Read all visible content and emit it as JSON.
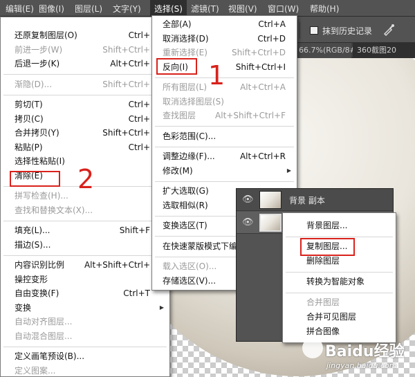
{
  "menubar": {
    "items": [
      {
        "label": "编辑(E)",
        "active": false
      },
      {
        "label": "图像(I)",
        "active": false
      },
      {
        "label": "图层(L)",
        "active": false
      },
      {
        "label": "文字(Y)",
        "active": false
      },
      {
        "label": "选择(S)",
        "active": true
      },
      {
        "label": "滤镜(T)",
        "active": false
      },
      {
        "label": "视图(V)",
        "active": false
      },
      {
        "label": "窗口(W)",
        "active": false
      },
      {
        "label": "帮助(H)",
        "active": false
      }
    ]
  },
  "options_bar": {
    "sample_all_layers_checkbox": false,
    "erase_to_history_label": "抹到历史记录",
    "brush_icon": "airbrush-icon"
  },
  "document_tabs": [
    {
      "label": "66.7%(RGB/8#)"
    },
    {
      "label": "360截图20"
    }
  ],
  "edit_menu": {
    "items": [
      {
        "label": "还原复制图层(O)",
        "shortcut": "Ctrl+",
        "disabled": false
      },
      {
        "label": "前进一步(W)",
        "shortcut": "Shift+Ctrl+",
        "disabled": true
      },
      {
        "label": "后退一步(K)",
        "shortcut": "Alt+Ctrl+",
        "disabled": false
      },
      {
        "sep": true
      },
      {
        "label": "渐隐(D)...",
        "shortcut": "Shift+Ctrl+",
        "disabled": true
      },
      {
        "sep": true
      },
      {
        "label": "剪切(T)",
        "shortcut": "Ctrl+",
        "disabled": false
      },
      {
        "label": "拷贝(C)",
        "shortcut": "Ctrl+",
        "disabled": false
      },
      {
        "label": "合并拷贝(Y)",
        "shortcut": "Shift+Ctrl+",
        "disabled": false
      },
      {
        "label": "粘贴(P)",
        "shortcut": "Ctrl+",
        "disabled": false
      },
      {
        "label": "选择性粘贴(I)",
        "shortcut": "",
        "disabled": false
      },
      {
        "label": "清除(E)",
        "shortcut": "",
        "disabled": false,
        "highlight": true
      },
      {
        "sep": true
      },
      {
        "label": "拼写检查(H)...",
        "shortcut": "",
        "disabled": true
      },
      {
        "label": "查找和替换文本(X)...",
        "shortcut": "",
        "disabled": true
      },
      {
        "sep": true
      },
      {
        "label": "填充(L)...",
        "shortcut": "Shift+F",
        "disabled": false
      },
      {
        "label": "描边(S)...",
        "shortcut": "",
        "disabled": false
      },
      {
        "sep": true
      },
      {
        "label": "内容识别比例",
        "shortcut": "Alt+Shift+Ctrl+",
        "disabled": false
      },
      {
        "label": "操控变形",
        "shortcut": "",
        "disabled": false
      },
      {
        "label": "自由变换(F)",
        "shortcut": "Ctrl+T",
        "disabled": false
      },
      {
        "label": "变换",
        "shortcut": "",
        "disabled": false,
        "submenu": true
      },
      {
        "label": "自动对齐图层...",
        "shortcut": "",
        "disabled": true
      },
      {
        "label": "自动混合图层...",
        "shortcut": "",
        "disabled": true
      },
      {
        "sep": true
      },
      {
        "label": "定义画笔预设(B)...",
        "shortcut": "",
        "disabled": false
      },
      {
        "label": "定义图案...",
        "shortcut": "",
        "disabled": true
      }
    ]
  },
  "select_menu": {
    "items": [
      {
        "label": "全部(A)",
        "shortcut": "Ctrl+A",
        "disabled": false
      },
      {
        "label": "取消选择(D)",
        "shortcut": "Ctrl+D",
        "disabled": false
      },
      {
        "label": "重新选择(E)",
        "shortcut": "Shift+Ctrl+D",
        "disabled": true
      },
      {
        "label": "反向(I)",
        "shortcut": "Shift+Ctrl+I",
        "disabled": false,
        "highlight": true
      },
      {
        "sep": true
      },
      {
        "label": "所有图层(L)",
        "shortcut": "Alt+Ctrl+A",
        "disabled": true
      },
      {
        "label": "取消选择图层(S)",
        "shortcut": "",
        "disabled": true
      },
      {
        "label": "查找图层",
        "shortcut": "Alt+Shift+Ctrl+F",
        "disabled": true
      },
      {
        "sep": true
      },
      {
        "label": "色彩范围(C)...",
        "shortcut": "",
        "disabled": false
      },
      {
        "sep": true
      },
      {
        "label": "调整边缘(F)...",
        "shortcut": "Alt+Ctrl+R",
        "disabled": false
      },
      {
        "label": "修改(M)",
        "shortcut": "",
        "disabled": false,
        "submenu": true
      },
      {
        "sep": true
      },
      {
        "label": "扩大选取(G)",
        "shortcut": "",
        "disabled": false
      },
      {
        "label": "选取相似(R)",
        "shortcut": "",
        "disabled": false
      },
      {
        "sep": true
      },
      {
        "label": "变换选区(T)",
        "shortcut": "",
        "disabled": false
      },
      {
        "sep": true
      },
      {
        "label": "在快速蒙版模式下编",
        "shortcut": "",
        "disabled": false
      },
      {
        "sep": true
      },
      {
        "label": "载入选区(O)...",
        "shortcut": "",
        "disabled": true
      },
      {
        "label": "存储选区(V)...",
        "shortcut": "",
        "disabled": false
      }
    ]
  },
  "layers": [
    {
      "name": "背景 副本",
      "selected": false
    },
    {
      "name": "",
      "selected": true
    }
  ],
  "layer_context_menu": {
    "items": [
      {
        "label": "背景图层...",
        "disabled": false
      },
      {
        "sep": true
      },
      {
        "label": "复制图层...",
        "disabled": false,
        "highlight": true
      },
      {
        "label": "删除图层",
        "disabled": false
      },
      {
        "sep": true
      },
      {
        "label": "转换为智能对象",
        "disabled": false
      },
      {
        "sep": true
      },
      {
        "label": "合并图层",
        "disabled": true
      },
      {
        "label": "合并可见图层",
        "disabled": false
      },
      {
        "label": "拼合图像",
        "disabled": false
      }
    ]
  },
  "annotations": {
    "step1": "1",
    "step2": "2"
  },
  "watermark": {
    "text": "Baidu经验",
    "url": "jingyan.baidu.com"
  },
  "colors": {
    "highlight_red": "#d9211b",
    "menubar_bg": "#535353",
    "menu_bg": "#ffffff",
    "disabled_text": "#9b9b9b"
  }
}
